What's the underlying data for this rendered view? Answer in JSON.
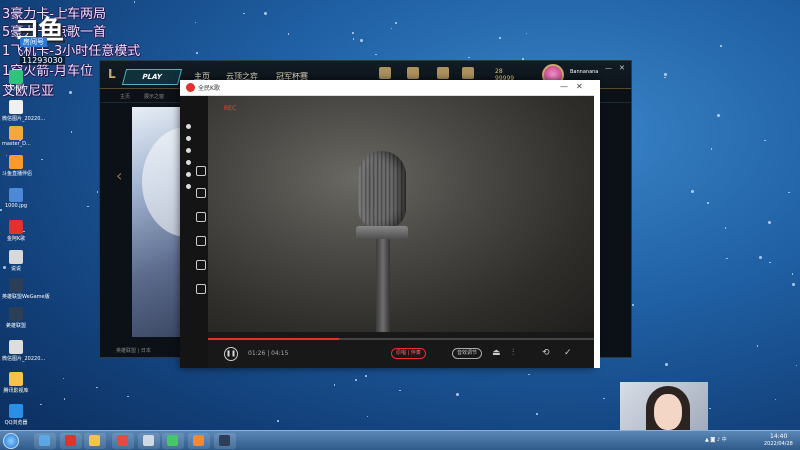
{
  "overlay": {
    "lines": [
      "3豪力卡-上车两局",
      "5豪力卡-点歌一首",
      "1飞机卡-3小时任意模式",
      "1穿火箭-月车位",
      "艾欧尼亚"
    ],
    "logo_text": "ヨ鱼",
    "logo_badge": "房间号",
    "room_id": "11293030"
  },
  "desktop_icons": [
    {
      "label": "QQ音乐",
      "color": "#31c27c"
    },
    {
      "label": "微信图片_20220...",
      "color": "#f0f0f0"
    },
    {
      "label": "master_D...",
      "color": "#f3a93a"
    },
    {
      "label": "斗鱼直播伴侣",
      "color": "#ff9a2a"
    },
    {
      "label": "1000.jpg",
      "color": "#4c8ad8"
    },
    {
      "label": "金阿K歌",
      "color": "#e3322e"
    },
    {
      "label": "说说",
      "color": "#d9d9d9"
    },
    {
      "label": "英雄联盟WeGame版",
      "color": "#2c3f56"
    },
    {
      "label": "英雄联盟",
      "color": "#2c3f56"
    },
    {
      "label": "微信图片_20220...",
      "color": "#dddddd"
    },
    {
      "label": "腾讯影视库",
      "color": "#f5c24a"
    },
    {
      "label": "QQ浏览器",
      "color": "#2b8fe8"
    }
  ],
  "game": {
    "play_label": "PLAY",
    "logo": "L",
    "nav": [
      "主页",
      "云顶之弈",
      "冠军杯赛"
    ],
    "icons": [
      "商城",
      "战利品",
      "收藏",
      "生涯"
    ],
    "coins": "28",
    "coins2": "99999",
    "username": "Bannanana",
    "subnav": [
      "主页",
      "展示之窗"
    ],
    "footer": "英雄联盟 | 日本",
    "window_controls": [
      "—",
      "✕"
    ]
  },
  "player": {
    "title": "全民K歌",
    "controls": [
      "—",
      "✕"
    ],
    "rec": "REC",
    "progress": 0.34,
    "time": "01:26 | 04:15",
    "pill1": "原唱 | 伴奏",
    "pill2": "音效调节",
    "icons": [
      "⏏",
      "⫶",
      "⟲",
      "✓"
    ],
    "accent": "#e3322e"
  },
  "taskbar": {
    "tray": "▲ ◙ ♪ 中",
    "time": "14:40",
    "date": "2022/04/28",
    "app_colors": [
      "#5aa9e6",
      "#e3322e",
      "#f5c24a",
      "#e84a43",
      "#cfd8e3",
      "#44c767",
      "#f08a2c",
      "#2c3f56"
    ]
  }
}
